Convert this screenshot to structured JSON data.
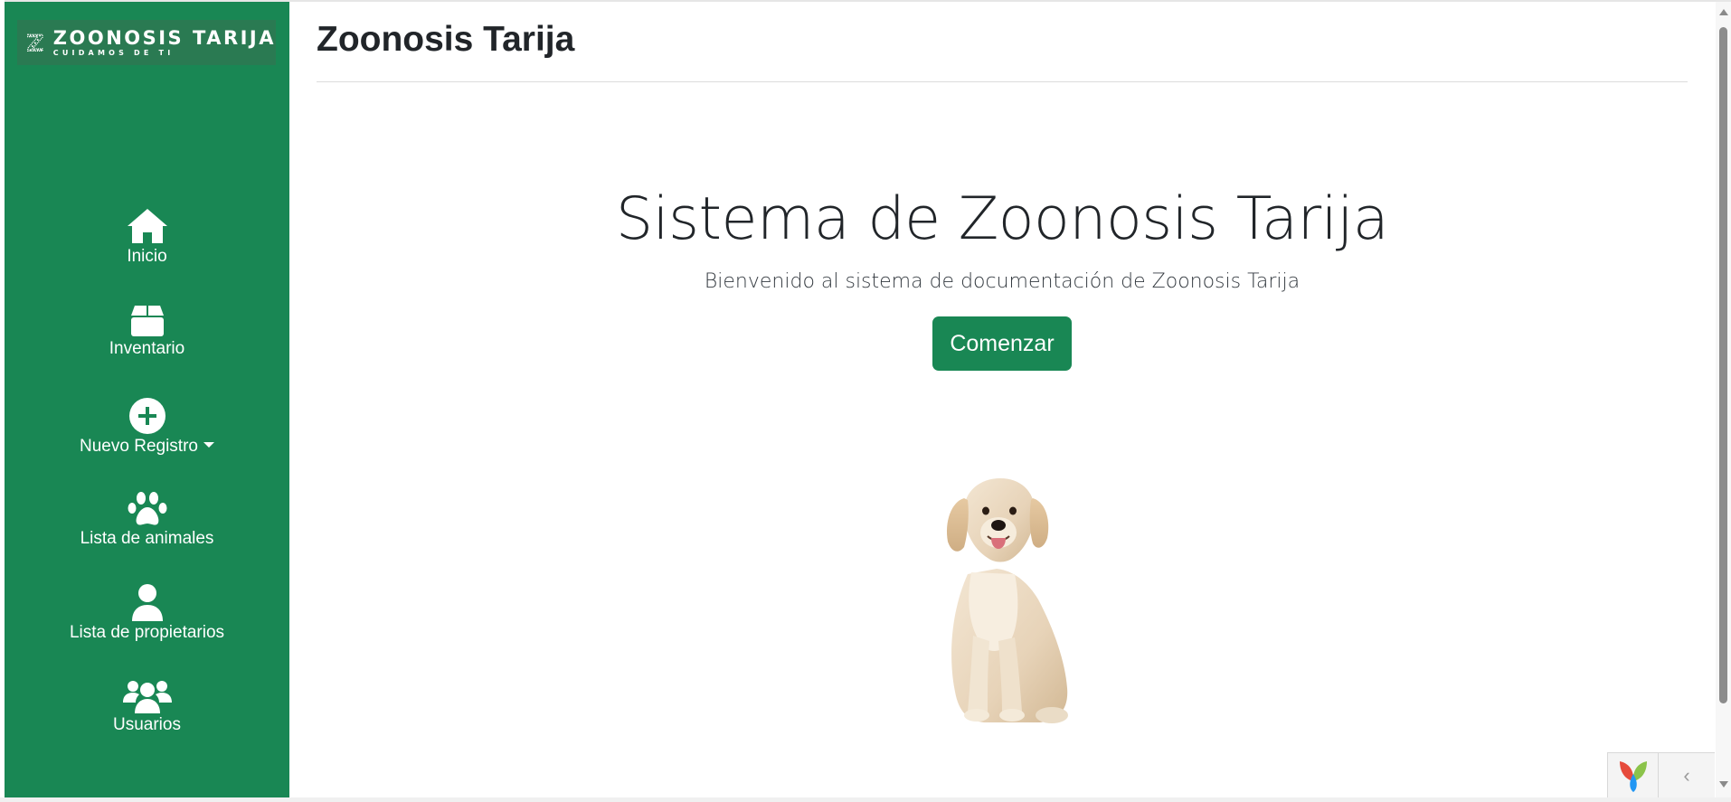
{
  "brand": {
    "title": "ZOONOSIS TARIJA",
    "tagline": "CUIDAMOS DE TI",
    "logo_icon": "z-logo-icon",
    "color": "#198754"
  },
  "sidebar": {
    "items": [
      {
        "label": "Inicio",
        "icon": "home-icon"
      },
      {
        "label": "Inventario",
        "icon": "box-icon"
      },
      {
        "label": "Nuevo Registro",
        "icon": "plus-circle-icon",
        "dropdown": true
      },
      {
        "label": "Lista de animales",
        "icon": "paw-icon"
      },
      {
        "label": "Lista de propietarios",
        "icon": "user-icon"
      },
      {
        "label": "Usuarios",
        "icon": "users-icon"
      }
    ]
  },
  "header": {
    "title": "Zoonosis Tarija"
  },
  "hero": {
    "title": "Sistema de Zoonosis Tarija",
    "subtitle": "Bienvenido al sistema de documentación de Zoonosis Tarija",
    "cta_label": "Comenzar",
    "image": "dog-illustration"
  },
  "toolbar": {
    "logo_icon": "yii-logo-icon",
    "toggle_icon": "chevron-left-icon",
    "toggle_glyph": "‹"
  }
}
